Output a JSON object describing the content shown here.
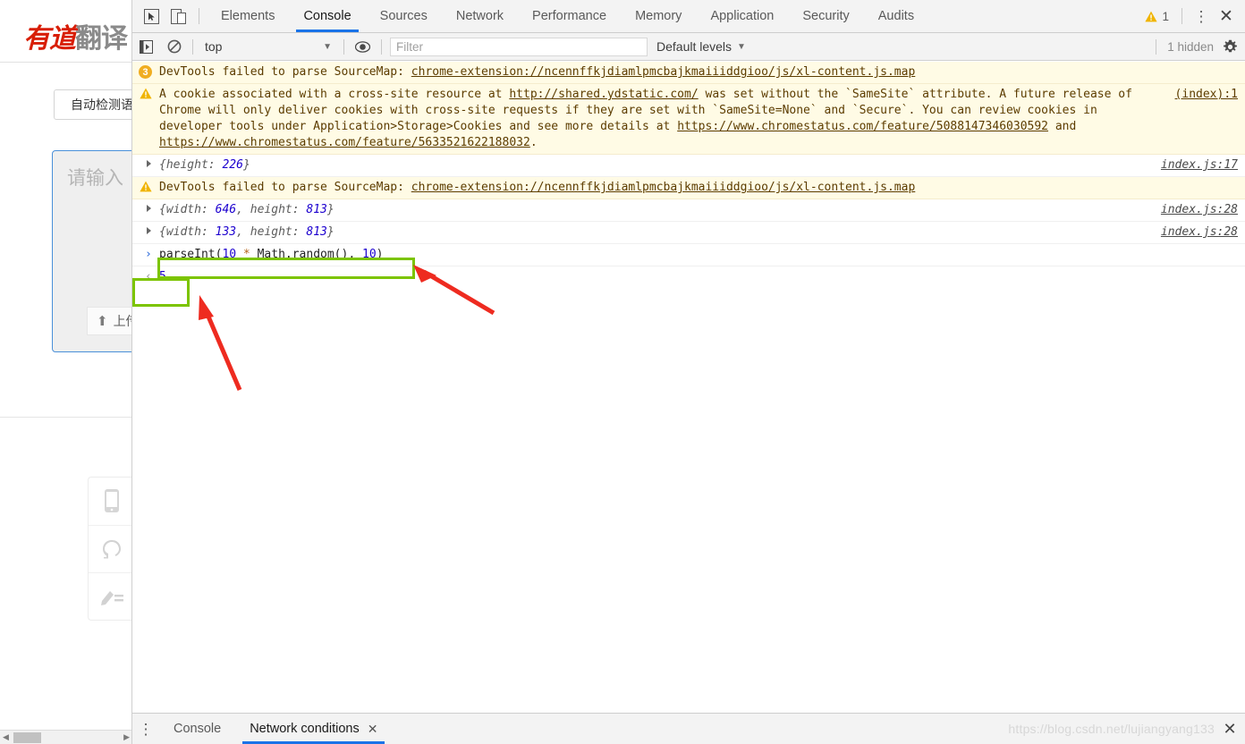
{
  "left_page": {
    "logo_red": "有道",
    "logo_gray": "翻译",
    "detect_label": "自动检测语",
    "textarea_placeholder": "请输入",
    "upload_label": "上传",
    "upload_icon": "upload-arrow-icon",
    "icons": [
      "mobile-phone-icon",
      "headset-icon",
      "pen-edit-icon"
    ]
  },
  "devtools": {
    "tabbar": {
      "inspect_icon": "inspect-element-icon",
      "device_icon": "toggle-device-toolbar-icon",
      "tabs": [
        {
          "label": "Elements",
          "active": false
        },
        {
          "label": "Console",
          "active": true
        },
        {
          "label": "Sources",
          "active": false
        },
        {
          "label": "Network",
          "active": false
        },
        {
          "label": "Performance",
          "active": false
        },
        {
          "label": "Memory",
          "active": false
        },
        {
          "label": "Application",
          "active": false
        },
        {
          "label": "Security",
          "active": false
        },
        {
          "label": "Audits",
          "active": false
        }
      ],
      "warning_icon": "warning-triangle-icon",
      "warning_count": "1",
      "kebab_icon": "more-options-icon",
      "close_icon": "close-icon"
    },
    "filterbar": {
      "sidebar_icon": "console-sidebar-icon",
      "clear_icon": "clear-console-icon",
      "context": "top",
      "context_caret": "chevron-down-icon",
      "eye_icon": "live-expression-icon",
      "filter_placeholder": "Filter",
      "levels_label": "Default levels",
      "levels_caret": "chevron-down-icon",
      "hidden_label": "1 hidden",
      "gear_icon": "console-settings-gear-icon"
    },
    "messages": [
      {
        "kind": "warning",
        "marker": "badge",
        "badge": "3",
        "text_before": "DevTools failed to parse SourceMap: ",
        "link": "chrome-extension://ncennffkjdiamlpmcbajkmaiiiddgioo/js/xl-content.js.map",
        "text_after": "",
        "source": ""
      },
      {
        "kind": "warning",
        "marker": "triangle",
        "segments": [
          {
            "type": "text",
            "value": "A cookie associated with a cross-site resource at "
          },
          {
            "type": "link",
            "value": "http://shared.ydstatic.com/"
          },
          {
            "type": "text",
            "value": " was set without the `SameSite` attribute. A future release of Chrome will only deliver cookies with cross-site requests if they are set with `SameSite=None` and `Secure`. You can review cookies in developer tools under Application>Storage>Cookies and see more details at "
          },
          {
            "type": "link",
            "value": "https://www.chromestatus.com/feature/5088147346030592"
          },
          {
            "type": "text",
            "value": " and "
          },
          {
            "type": "link",
            "value": "https://www.chromestatus.com/feature/5633521622188032"
          },
          {
            "type": "text",
            "value": "."
          }
        ],
        "source": "(index):1"
      },
      {
        "kind": "object",
        "text": "{height: 226}",
        "props": [
          {
            "key": "height",
            "value": "226"
          }
        ],
        "source": "index.js:17"
      },
      {
        "kind": "warning",
        "marker": "triangle",
        "text_before": "DevTools failed to parse SourceMap: ",
        "link": "chrome-extension://ncennffkjdiamlpmcbajkmaiiiddgioo/js/xl-content.js.map",
        "source": ""
      },
      {
        "kind": "object",
        "text": "{width: 646, height: 813}",
        "props": [
          {
            "key": "width",
            "value": "646"
          },
          {
            "key": "height",
            "value": "813"
          }
        ],
        "source": "index.js:28"
      },
      {
        "kind": "object",
        "text": "{width: 133, height: 813}",
        "props": [
          {
            "key": "width",
            "value": "133"
          },
          {
            "key": "height",
            "value": "813"
          }
        ],
        "source": "index.js:28"
      }
    ],
    "prompt": {
      "chevron": "›",
      "expression": "parseInt(10 * Math.random(), 10)",
      "part_fn_open": "parseInt(",
      "part_num1": "10",
      "part_op": " * ",
      "part_mid": "Math.random(), ",
      "part_num2": "10",
      "part_close": ")"
    },
    "result": {
      "chevron": "‹",
      "value": "5"
    },
    "drawer": {
      "kebab_icon": "drawer-more-options-icon",
      "tabs": [
        {
          "label": "Console",
          "active": false,
          "closable": false
        },
        {
          "label": "Network conditions",
          "active": true,
          "closable": true
        }
      ],
      "close_tab_icon": "close-tab-icon",
      "close_icon": "close-drawer-icon"
    }
  },
  "watermark": {
    "text": "https://blog.csdn.net/lujiangyang133"
  },
  "annotations": {
    "highlight_color": "#7cc400",
    "arrow_color": "#ee2b20",
    "boxes": [
      "prompt-expression-highlight",
      "result-value-highlight"
    ],
    "arrows": [
      "arrow-to-expression",
      "arrow-to-result"
    ]
  }
}
